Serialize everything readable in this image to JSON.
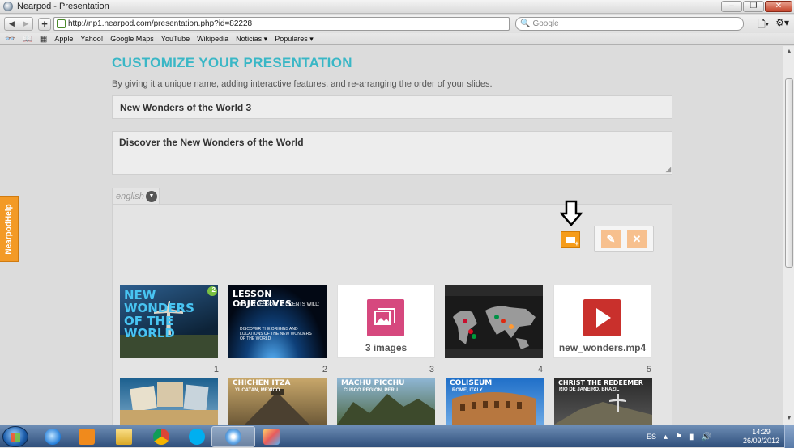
{
  "window": {
    "title": "Nearpod - Presentation"
  },
  "toolbar": {
    "url": "http://np1.nearpod.com/presentation.php?id=82228",
    "search_placeholder": "Google",
    "back_label": "◀",
    "forward_label": "▶",
    "add_label": "+"
  },
  "bookmarks": [
    "Apple",
    "Yahoo!",
    "Google Maps",
    "YouTube",
    "Wikipedia",
    "Noticias ▾",
    "Populares ▾"
  ],
  "help_tab": "NearpodHelp",
  "page": {
    "heading": "CUSTOMIZE YOUR PRESENTATION",
    "subtext": "By giving it a unique name, adding interactive features, and re-arranging the order of your slides.",
    "title_value": "New Wonders of the World 3",
    "description_value": "Discover the New Wonders of the World",
    "language_placeholder": "english"
  },
  "slides": [
    {
      "num": "1",
      "caption": "NEW WONDERS OF THE WORLD",
      "badge": "2"
    },
    {
      "num": "2",
      "caption": "LESSON OBJECTIVES",
      "sub": "IN THIS LESSON, STUDENTS WILL:",
      "note": "DISCOVER THE ORIGINS AND LOCATIONS OF THE NEW WONDERS OF THE WORLD"
    },
    {
      "num": "3",
      "label": "3 images"
    },
    {
      "num": "4"
    },
    {
      "num": "5",
      "label": "new_wonders.mp4"
    },
    {
      "caption": "CHICHEN ITZA",
      "sub": "YUCATAN, MEXICO"
    },
    {
      "caption": "MACHU PICCHU",
      "sub": "CUSCO REGION, PERU"
    },
    {
      "caption": "COLISEUM",
      "sub": "ROME, ITALY"
    },
    {
      "caption": "CHRIST THE REDEEMER",
      "sub": "RIO DE JANEIRO, BRAZIL"
    }
  ],
  "taskbar": {
    "language": "ES",
    "time": "14:29",
    "date": "26/09/2012"
  },
  "colors": {
    "accent": "#3ab7c6",
    "orange": "#f59c1a"
  }
}
